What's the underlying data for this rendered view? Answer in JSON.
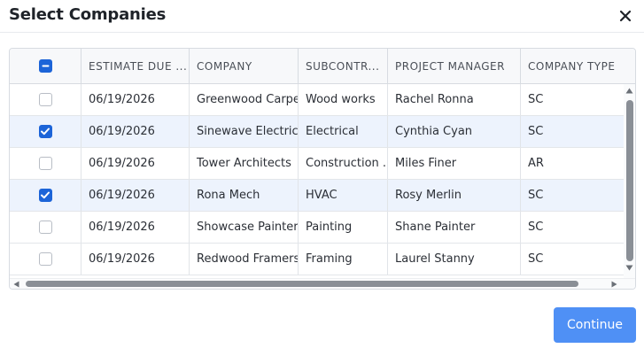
{
  "dialog": {
    "title": "Select Companies",
    "close_icon": "close-icon"
  },
  "table": {
    "header_checkbox_state": "partial",
    "columns": [
      "ESTIMATE DUE ...",
      "COMPANY",
      "SUBCONTR...",
      "PROJECT MANAGER",
      "COMPANY TYPE"
    ],
    "rows": [
      {
        "checked": false,
        "due": "06/19/2026",
        "company": "Greenwood Carpe...",
        "subcontract": "Wood works",
        "manager": "Rachel Ronna",
        "type": "SC"
      },
      {
        "checked": true,
        "due": "06/19/2026",
        "company": "Sinewave Electric...",
        "subcontract": "Electrical",
        "manager": "Cynthia Cyan",
        "type": "SC"
      },
      {
        "checked": false,
        "due": "06/19/2026",
        "company": "Tower Architects",
        "subcontract": "Construction ...",
        "manager": "Miles Finer",
        "type": "AR"
      },
      {
        "checked": true,
        "due": "06/19/2026",
        "company": "Rona Mech",
        "subcontract": "HVAC",
        "manager": "Rosy Merlin",
        "type": "SC"
      },
      {
        "checked": false,
        "due": "06/19/2026",
        "company": "Showcase Painters",
        "subcontract": "Painting",
        "manager": "Shane Painter",
        "type": "SC"
      },
      {
        "checked": false,
        "due": "06/19/2026",
        "company": "Redwood Framers",
        "subcontract": "Framing",
        "manager": "Laurel Stanny",
        "type": "SC"
      }
    ]
  },
  "footer": {
    "continue_label": "Continue"
  },
  "colors": {
    "accent": "#1c64d8",
    "button": "#4f90f5",
    "selected_row": "#edf3fd"
  }
}
